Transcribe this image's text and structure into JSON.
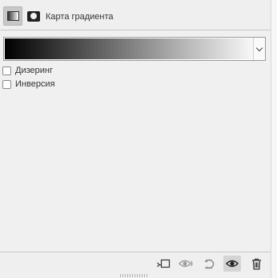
{
  "header": {
    "title": "Карта градиента",
    "icons": [
      "gradient-map-adjustment-icon",
      "layer-mask-icon"
    ]
  },
  "gradient": {
    "colors": [
      "#000000",
      "#ffffff"
    ]
  },
  "options": [
    {
      "label": "Дизеринг",
      "checked": false
    },
    {
      "label": "Инверсия",
      "checked": false
    }
  ],
  "footer": {
    "icons": [
      "clip-to-layer-icon",
      "view-previous-state-icon",
      "reset-icon",
      "toggle-visibility-icon",
      "delete-icon"
    ]
  },
  "colors": {
    "panel_bg": "#f0f0f0",
    "border": "#c9c9c9",
    "text": "#333333"
  }
}
